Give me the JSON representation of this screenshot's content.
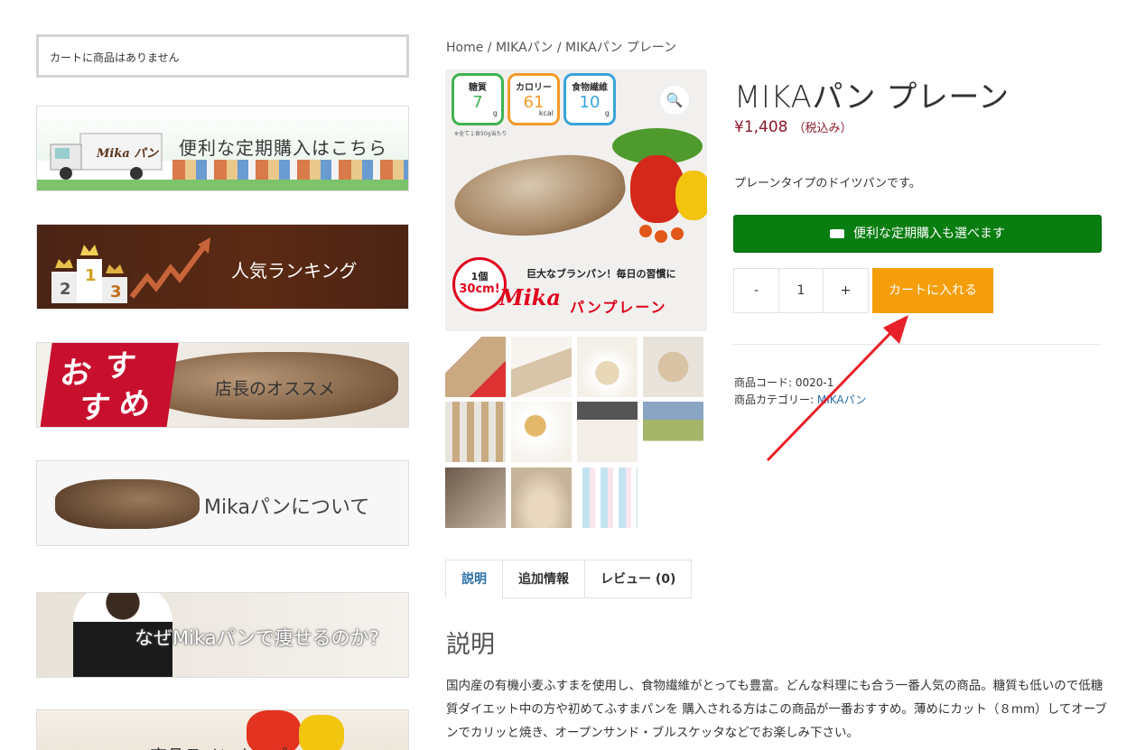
{
  "sidebar": {
    "cart_empty": "カートに商品はありません",
    "banners": [
      {
        "name": "subscription-banner",
        "text": "便利な定期購入はこちら",
        "logo": "Mika パン"
      },
      {
        "name": "ranking-banner",
        "text": "人気ランキング",
        "ranks": [
          "2",
          "1",
          "3"
        ]
      },
      {
        "name": "recommend-banner",
        "text": "店長のオススメ",
        "badge": [
          "お",
          "す",
          "す",
          "め"
        ]
      },
      {
        "name": "about-banner",
        "text": "Mikaパンについて"
      },
      {
        "name": "why-banner",
        "text": "なぜMikaパンで痩せるのか?"
      },
      {
        "name": "lineup-banner",
        "text": "商品ラインナップ"
      }
    ]
  },
  "breadcrumb": {
    "home": "Home",
    "sep": " / ",
    "cat": "MIKAパン",
    "current": "MIKAパン プレーン"
  },
  "product_image": {
    "nutrition": [
      {
        "label": "糖質",
        "value": "7",
        "unit": "g"
      },
      {
        "label": "カロリー",
        "value": "61",
        "unit": "kcal"
      },
      {
        "label": "食物繊維",
        "value": "10",
        "unit": "g"
      }
    ],
    "note": "※全て１食50g当たり",
    "badge_top": "1個",
    "badge_size": "30cm!",
    "catch": "巨大なブランパン！毎日の習慣に",
    "logo": "Mika",
    "logo_sub": "パンプレーン",
    "zoom_icon": "magnifier-icon"
  },
  "product": {
    "title": "MIKAパン プレーン",
    "price": "¥1,408",
    "tax_note": "（税込み）",
    "description": "プレーンタイプのドイツパンです。",
    "subscription_button": "便利な定期購入も選べます",
    "qty_minus": "-",
    "qty_value": "1",
    "qty_plus": "+",
    "add_to_cart": "カートに入れる",
    "sku_label": "商品コード: ",
    "sku": "0020-1",
    "category_label": "商品カテゴリー: ",
    "category": "MIKAパン"
  },
  "tabs": [
    {
      "label": "説明"
    },
    {
      "label": "追加情報"
    },
    {
      "label": "レビュー (0)"
    }
  ],
  "description_section": {
    "title": "説明",
    "text": "国内産の有機小麦ふすまを使用し、食物繊維がとっても豊富。どんな料理にも合う一番人気の商品。糖質も低いので低糖質ダイエット中の方や初めてふすまパンを 購入される方はこの商品が一番おすすめ。薄めにカット（８mm）してオーブンでカリッと焼き、オープンサンド・ブルスケッタなどでお楽しみ下さい。"
  },
  "colors": {
    "accent_green": "#087d10",
    "add_to_cart": "#f59e0b",
    "price": "#8b1a2b",
    "link": "#2a6fa8",
    "annotation_arrow": "#e8202a"
  }
}
